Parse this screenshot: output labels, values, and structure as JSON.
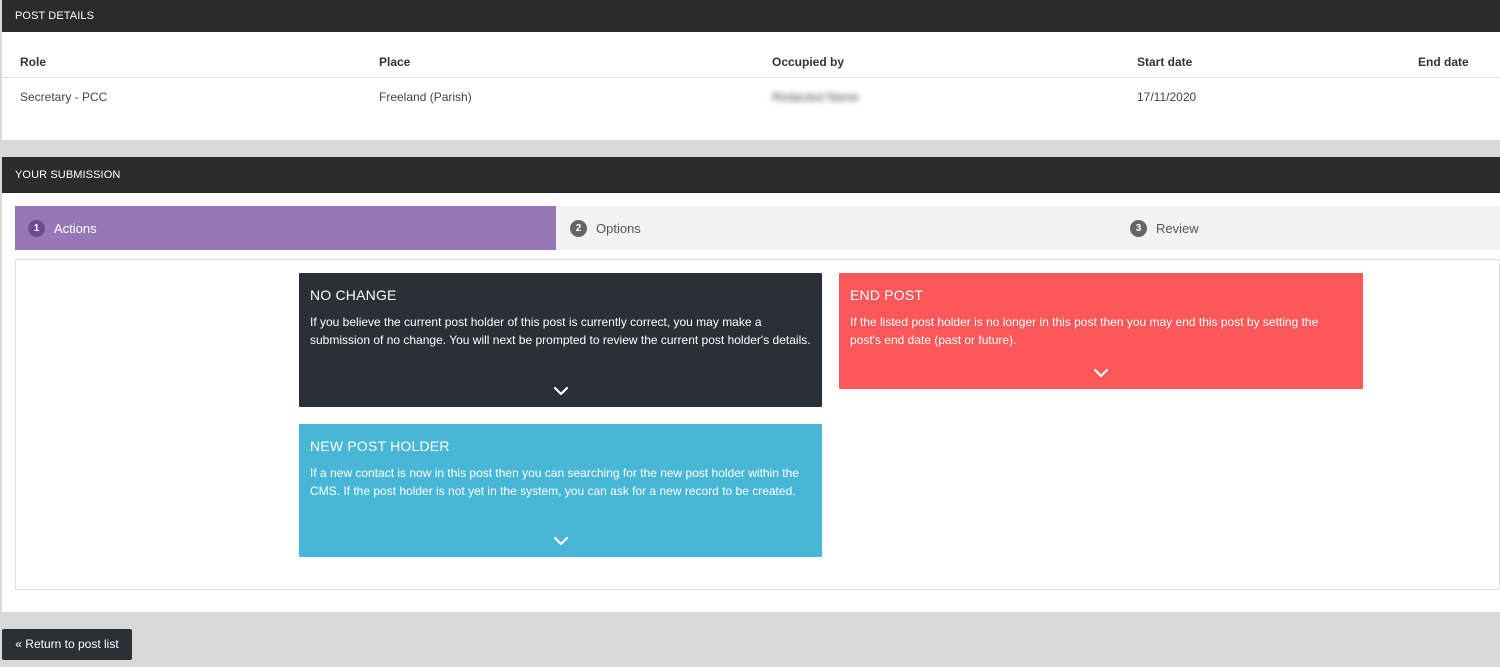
{
  "post_details": {
    "header": "POST DETAILS",
    "columns": [
      "Role",
      "Place",
      "Occupied by",
      "Start date",
      "End date"
    ],
    "row": {
      "role": "Secretary - PCC",
      "place": "Freeland (Parish)",
      "occupied_by": "Redacted Name",
      "start_date": "17/11/2020",
      "end_date": ""
    }
  },
  "submission": {
    "header": "YOUR SUBMISSION",
    "steps": [
      {
        "num": "1",
        "label": "Actions",
        "active": true
      },
      {
        "num": "2",
        "label": "Options",
        "active": false
      },
      {
        "num": "3",
        "label": "Review",
        "active": false
      }
    ],
    "cards": {
      "no_change": {
        "title": "NO CHANGE",
        "text": "If you believe the current post holder of this post is currently correct, you may make a submission of no change. You will next be prompted to review the current post holder's details."
      },
      "end_post": {
        "title": "END POST",
        "text": "If the listed post holder is no longer in this post then you may end this post by setting the post's end date (past or future)."
      },
      "new_holder": {
        "title": "NEW POST HOLDER",
        "text": "If a new contact is now in this post then you can searching for the new post holder within the CMS. If the post holder is not yet in the system, you can ask for a new record to be created."
      }
    }
  },
  "footer": {
    "return_label": "« Return to post list"
  },
  "colors": {
    "header_bg": "#2b2b2b",
    "step_active": "#9778b6",
    "card_dark": "#2b3036",
    "card_red": "#fc5859",
    "card_blue": "#48b6d7"
  },
  "icons": {
    "card_expand": "chevron-down-icon"
  }
}
